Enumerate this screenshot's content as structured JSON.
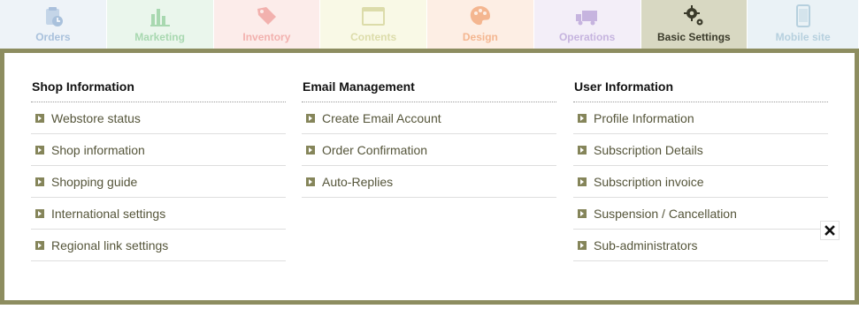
{
  "tabs": [
    {
      "label": "Orders",
      "icon": "cart-clock-icon",
      "color": "#a9c1dc"
    },
    {
      "label": "Marketing",
      "icon": "bar-chart-icon",
      "color": "#a8d8b0"
    },
    {
      "label": "Inventory",
      "icon": "price-tag-icon",
      "color": "#f2b1ae"
    },
    {
      "label": "Contents",
      "icon": "window-icon",
      "color": "#dcdcaa"
    },
    {
      "label": "Design",
      "icon": "palette-icon",
      "color": "#f4b690"
    },
    {
      "label": "Operations",
      "icon": "truck-icon",
      "color": "#c6b4df"
    },
    {
      "label": "Basic Settings",
      "icon": "gears-icon",
      "color": "#3a3a2a",
      "active": true
    },
    {
      "label": "Mobile site",
      "icon": "smartphone-icon",
      "color": "#b6d0de"
    }
  ],
  "panel": {
    "accent_color": "#8d8d60",
    "columns": [
      {
        "title": "Shop Information",
        "items": [
          "Webstore status",
          "Shop information",
          "Shopping guide",
          "International settings",
          "Regional link settings"
        ]
      },
      {
        "title": "Email Management",
        "items": [
          "Create Email Account",
          "Order Confirmation",
          "Auto-Replies"
        ]
      },
      {
        "title": "User Information",
        "items": [
          "Profile Information",
          "Subscription Details",
          "Subscription invoice",
          "Suspension / Cancellation",
          "Sub-administrators"
        ]
      }
    ],
    "close_icon": "close-icon"
  }
}
